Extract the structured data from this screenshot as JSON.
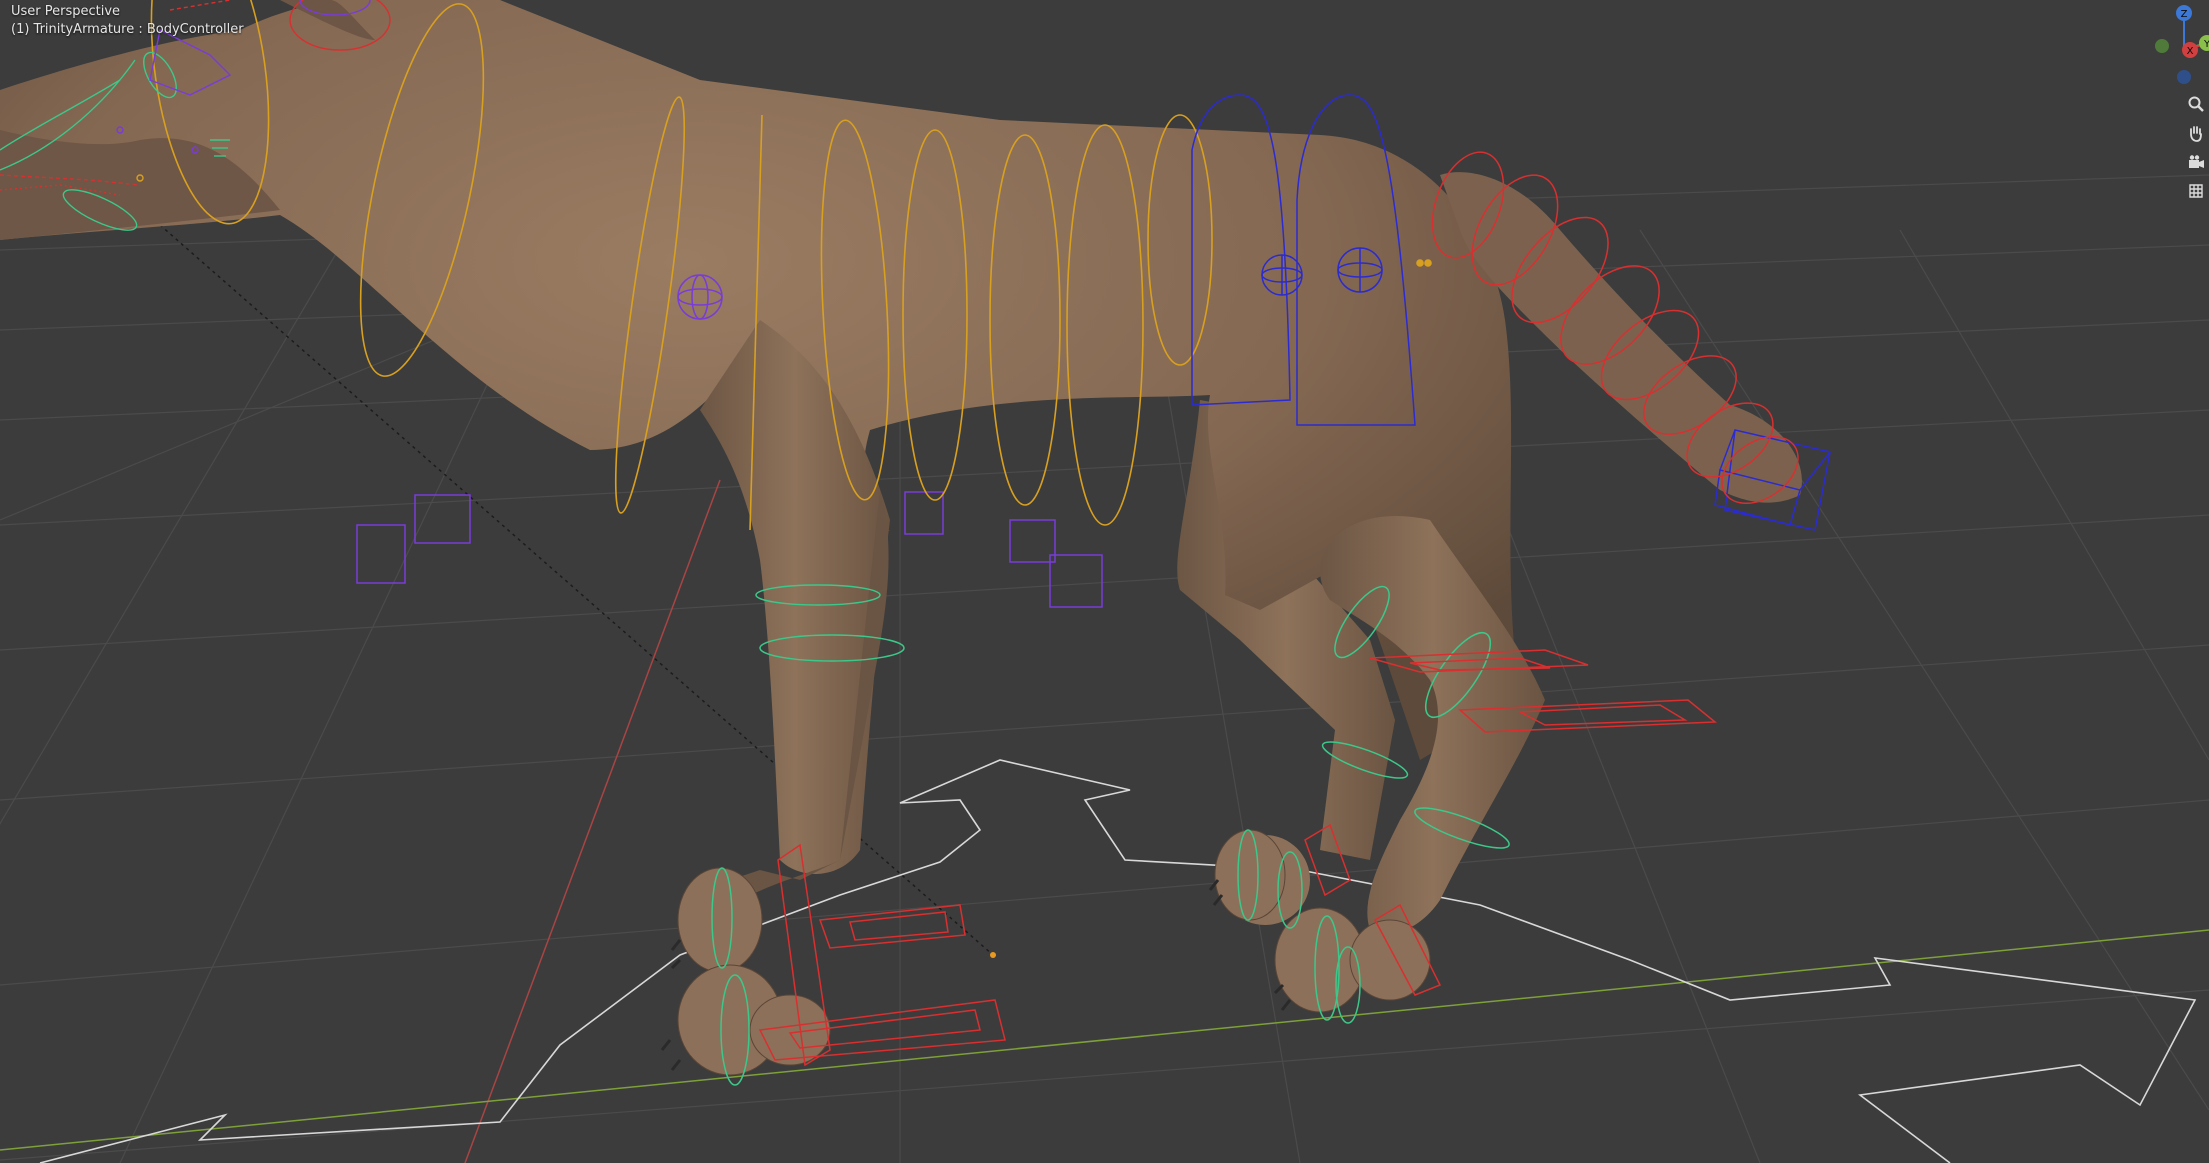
{
  "viewport": {
    "view_name": "User Perspective",
    "object_info": "(1) TrinityArmature : BodyController"
  },
  "gizmo": {
    "z_label": "Z",
    "x_label": "X",
    "y_label": "Y"
  },
  "nav_tools": [
    {
      "name": "zoom",
      "icon": "zoom-icon",
      "glyph": "⌕"
    },
    {
      "name": "pan",
      "icon": "hand-icon",
      "glyph": "✋"
    },
    {
      "name": "camera",
      "icon": "camera-icon",
      "glyph": "🎥"
    },
    {
      "name": "grid",
      "icon": "grid-icon",
      "glyph": "▦"
    }
  ],
  "colors": {
    "background": "#3c3c3c",
    "grid": "#4a4a4a",
    "mesh": "#8a6e57",
    "bone_yellow": "#d8a020",
    "bone_blue": "#2b2bd0",
    "bone_red": "#d83030",
    "bone_green": "#3cc88a",
    "bone_purple": "#7a3cd8",
    "axis_x": "#b04040",
    "axis_y": "#7ea03a"
  }
}
